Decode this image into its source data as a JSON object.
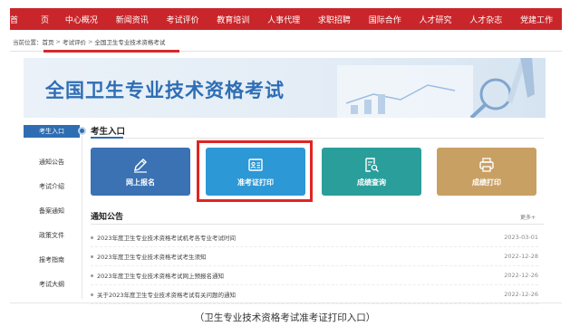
{
  "nav": {
    "items": [
      "首　页",
      "中心概况",
      "新闻资讯",
      "考试评价",
      "教育培训",
      "人事代理",
      "求职招聘",
      "国际合作",
      "人才研究",
      "人才杂志",
      "党建工作"
    ]
  },
  "breadcrumb": {
    "prefix": "当前位置：",
    "items": [
      "首页",
      "考试评价",
      "全国卫生专业技术资格考试"
    ],
    "separator": ">"
  },
  "banner": {
    "title": "全国卫生专业技术资格考试"
  },
  "sidebar": {
    "items": [
      "考生入口",
      "通知公告",
      "考试介绍",
      "备案通知",
      "政策文件",
      "报考指南",
      "考试大纲"
    ],
    "active_index": 0
  },
  "section": {
    "title": "考生入口"
  },
  "tiles": [
    {
      "label": "网上报名",
      "icon": "pencil-icon",
      "color": "#3a72b4"
    },
    {
      "label": "准考证打印",
      "icon": "id-card-icon",
      "color": "#2d98d6"
    },
    {
      "label": "成绩查询",
      "icon": "search-document-icon",
      "color": "#2a9e9b"
    },
    {
      "label": "成绩打印",
      "icon": "printer-icon",
      "color": "#c9a064"
    }
  ],
  "notices": {
    "title": "通知公告",
    "more": "更多+",
    "items": [
      {
        "text": "2023年度卫生专业技术资格考试机考各专业考试时间",
        "date": "2023-03-01"
      },
      {
        "text": "2023年度卫生专业技术资格考试考生须知",
        "date": "2022-12-28"
      },
      {
        "text": "2023年度卫生专业技术资格考试网上预报名通知",
        "date": "2022-12-26"
      },
      {
        "text": "关于2023年度卫生专业技术资格考试有关问题的通知",
        "date": "2022-12-26"
      }
    ]
  },
  "caption": "（卫生专业技术资格考试准考证打印入口）",
  "colors": {
    "nav_red": "#c8262b",
    "accent_blue": "#2f6db3",
    "highlight_red": "#e02424"
  }
}
